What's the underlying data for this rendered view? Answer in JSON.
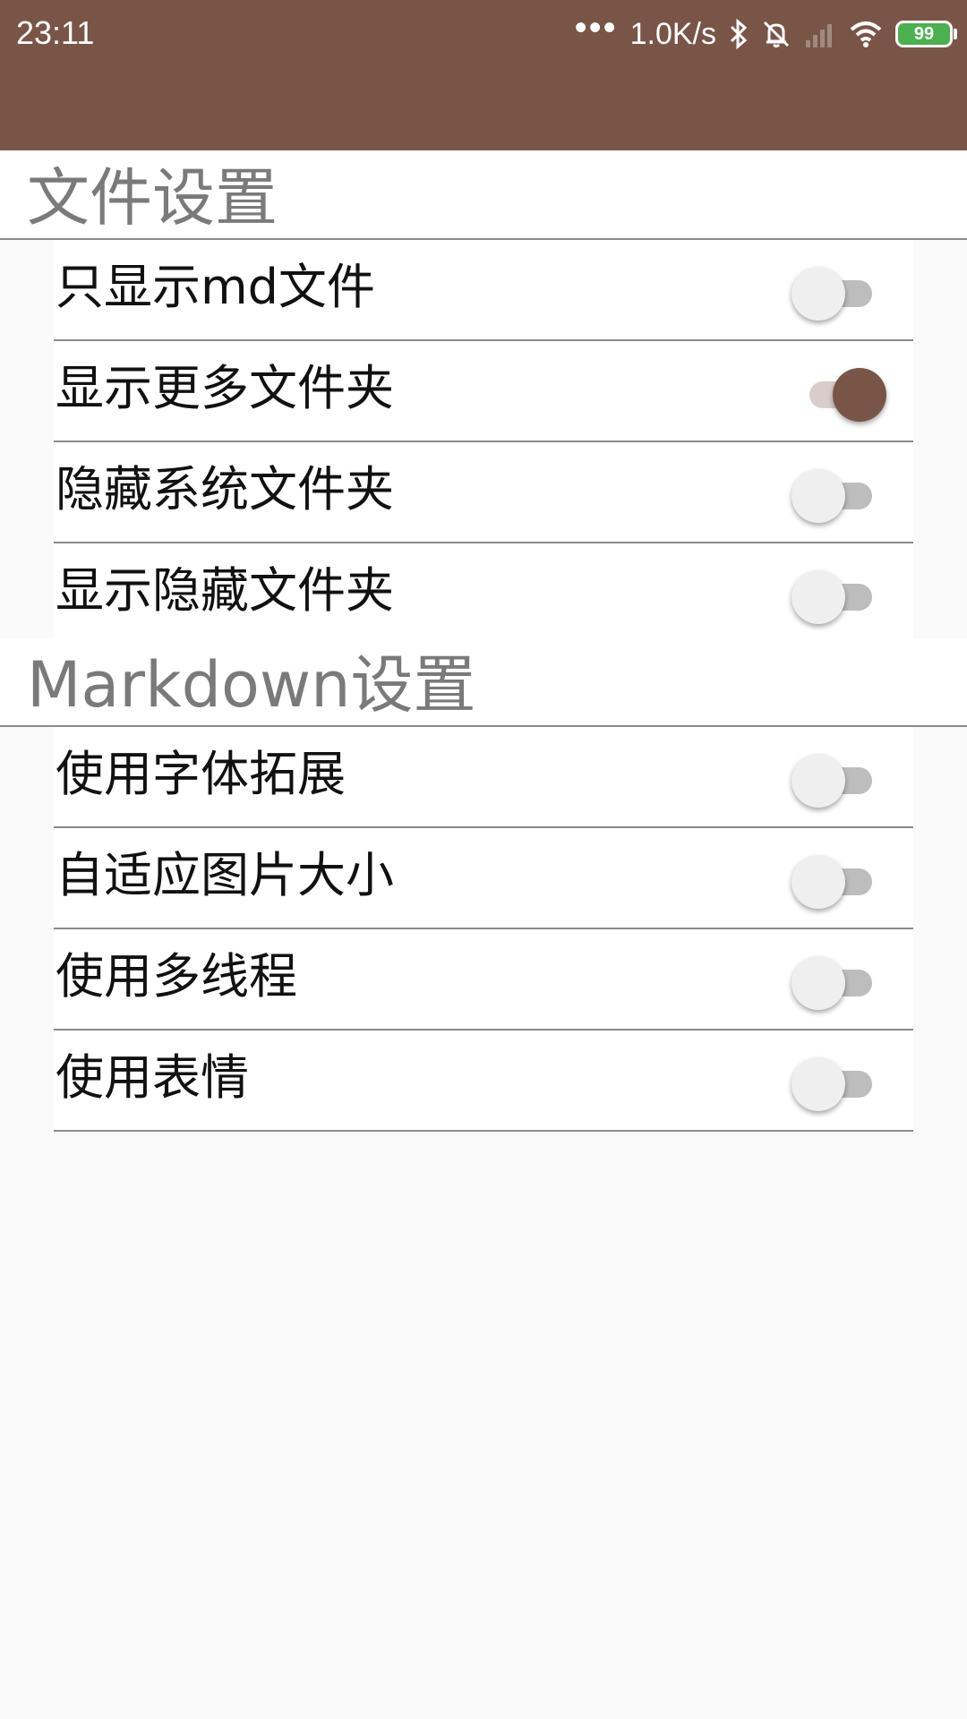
{
  "status_bar": {
    "time": "23:11",
    "dots": "•••",
    "net_speed": "1.0K/s",
    "battery": "99"
  },
  "colors": {
    "accent": "#795548",
    "switch_off_thumb": "#efefef",
    "switch_off_track": "#bdbdbd",
    "battery_fill": "#4caf50"
  },
  "sections": [
    {
      "title": "文件设置",
      "items": [
        {
          "label": "只显示md文件",
          "checked": false
        },
        {
          "label": "显示更多文件夹",
          "checked": true
        },
        {
          "label": "隐藏系统文件夹",
          "checked": false
        },
        {
          "label": "显示隐藏文件夹",
          "checked": false
        }
      ]
    },
    {
      "title": "Markdown设置",
      "items": [
        {
          "label": "使用字体拓展",
          "checked": false
        },
        {
          "label": "自适应图片大小",
          "checked": false
        },
        {
          "label": "使用多线程",
          "checked": false
        },
        {
          "label": "使用表情",
          "checked": false
        }
      ]
    }
  ]
}
